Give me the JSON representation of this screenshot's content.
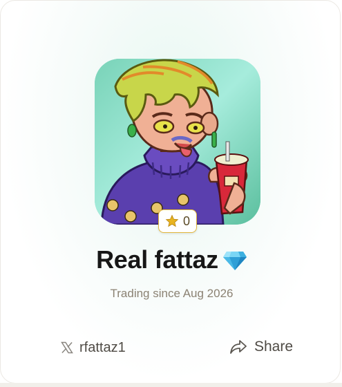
{
  "profile": {
    "name": "Real fattaz",
    "since": "Trading since Aug 2026",
    "badge_icon": "diamond-icon",
    "avatar": "cartoon-avatar-image"
  },
  "rating": {
    "icon": "star-icon",
    "count": "0"
  },
  "social": {
    "icon": "x-logo-icon",
    "handle": "rfattaz1"
  },
  "share": {
    "icon": "share-icon",
    "label": "Share"
  },
  "colors": {
    "avatar_bg": "#7fd6bd",
    "badge_border": "#e2b63a",
    "name_text": "#171717",
    "muted_text": "#8b8273"
  }
}
